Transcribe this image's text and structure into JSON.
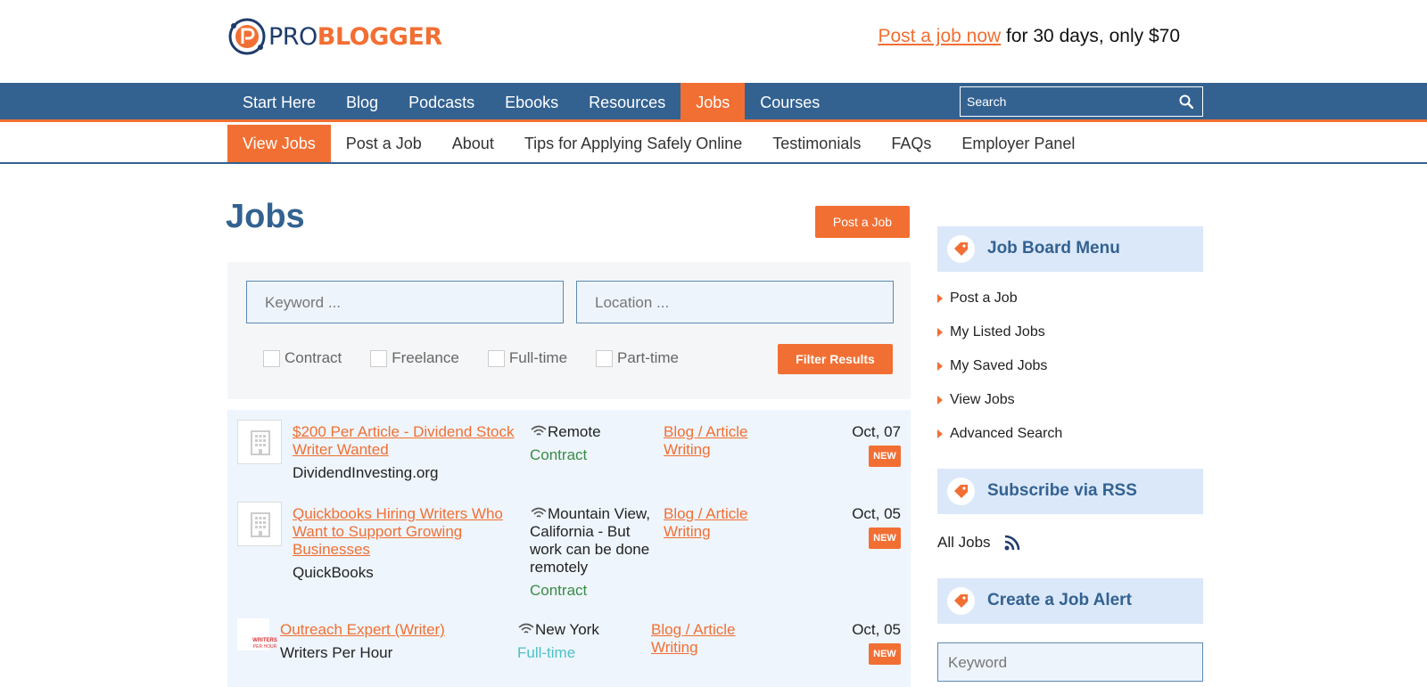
{
  "header": {
    "logo_pro": "PRO",
    "logo_blogger": "BLOGGER",
    "promo_link": "Post a job now",
    "promo_text": " for 30 days, only $70"
  },
  "mainnav": {
    "items": [
      "Start Here",
      "Blog",
      "Podcasts",
      "Ebooks",
      "Resources",
      "Jobs",
      "Courses"
    ],
    "active": "Jobs",
    "search_placeholder": "Search"
  },
  "subnav": {
    "items": [
      "View Jobs",
      "Post a Job",
      "About",
      "Tips for Applying Safely Online",
      "Testimonials",
      "FAQs",
      "Employer Panel"
    ],
    "active": "View Jobs"
  },
  "main": {
    "title": "Jobs",
    "post_button": "Post a Job",
    "filters": {
      "keyword_placeholder": "Keyword ...",
      "location_placeholder": "Location ...",
      "types": [
        "Contract",
        "Freelance",
        "Full-time",
        "Part-time"
      ],
      "button": "Filter Results"
    },
    "jobs": [
      {
        "title_lines": [
          "$200 Per Article - Dividend Stock",
          "Writer Wanted"
        ],
        "company": "DividendInvesting.org",
        "location_lines": [
          "Remote"
        ],
        "type": "Contract",
        "category_lines": [
          "Blog / Article",
          "Writing"
        ],
        "date": "Oct, 07",
        "badge": "NEW"
      },
      {
        "title_lines": [
          "Quickbooks Hiring Writers Who",
          "Want to Support Growing",
          "Businesses"
        ],
        "company": "QuickBooks",
        "location_lines": [
          "Mountain View,",
          "California - But",
          "work can be done",
          "remotely"
        ],
        "type": "Contract",
        "category_lines": [
          "Blog / Article",
          "Writing"
        ],
        "date": "Oct, 05",
        "badge": "NEW"
      },
      {
        "title_lines": [
          "Outreach Expert (Writer)"
        ],
        "company": "Writers Per Hour",
        "location_lines": [
          "New York"
        ],
        "type": "Full-time",
        "category_lines": [
          "Blog / Article",
          "Writing"
        ],
        "date": "Oct, 05",
        "badge": "NEW",
        "logo_text": "WRITERS PER HOUR"
      }
    ]
  },
  "sidebar": {
    "job_board_menu": {
      "heading": "Job Board Menu",
      "items": [
        "Post a Job",
        "My Listed Jobs",
        "My Saved Jobs",
        "View Jobs",
        "Advanced Search"
      ]
    },
    "rss": {
      "heading": "Subscribe via RSS",
      "link": "All Jobs"
    },
    "alert": {
      "heading": "Create a Job Alert",
      "keyword_placeholder": "Keyword"
    }
  },
  "colors": {
    "brand_orange": "#f26f33",
    "nav_blue": "#336291",
    "sidebar_head_bg": "#dbe8f9"
  }
}
